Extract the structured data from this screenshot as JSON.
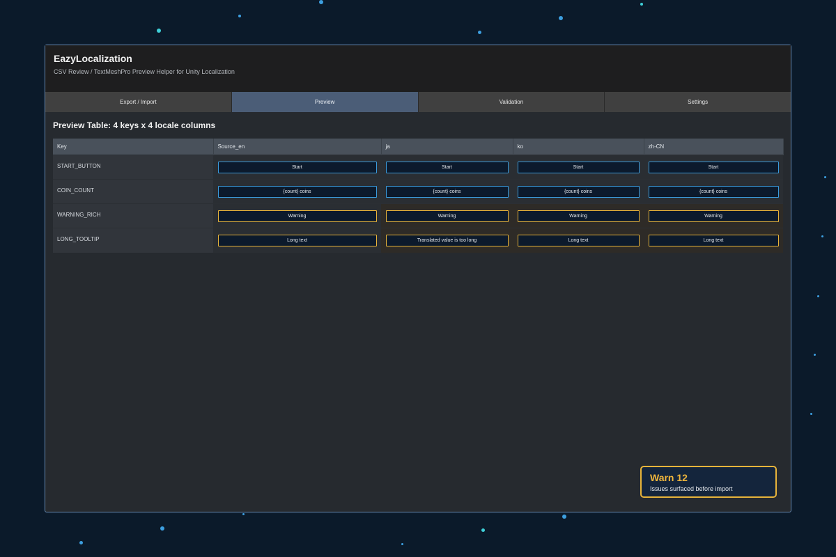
{
  "app": {
    "title": "EazyLocalization",
    "subtitle": "CSV Review / TextMeshPro Preview Helper for Unity Localization"
  },
  "tabs": [
    {
      "label": "Export / Import",
      "active": false
    },
    {
      "label": "Preview",
      "active": true
    },
    {
      "label": "Validation",
      "active": false
    },
    {
      "label": "Settings",
      "active": false
    }
  ],
  "preview": {
    "title": "Preview Table: 4 keys x 4 locale columns",
    "columns": [
      "Key",
      "Source_en",
      "ja",
      "ko",
      "zh-CN"
    ],
    "rows": [
      {
        "key": "START_BUTTON",
        "status": "ok",
        "cells": [
          "Start",
          "Start",
          "Start",
          "Start"
        ]
      },
      {
        "key": "COIN_COUNT",
        "status": "ok",
        "cells": [
          "{count} coins",
          "{count} coins",
          "{count} coins",
          "{count} coins"
        ]
      },
      {
        "key": "WARNING_RICH",
        "status": "warn",
        "cells": [
          "Warning",
          "Warning",
          "Warning",
          "Warning"
        ]
      },
      {
        "key": "LONG_TOOLTIP",
        "status": "warn",
        "cells": [
          "Long text",
          "Translated value is too long",
          "Long text",
          "Long text"
        ]
      }
    ]
  },
  "summary": {
    "count_label": "Warn 12",
    "description": "Issues surfaced before import"
  },
  "colors": {
    "ok_border": "#3a9bdc",
    "warn_border": "#e8b43a",
    "active_tab": "#4b5d77"
  }
}
